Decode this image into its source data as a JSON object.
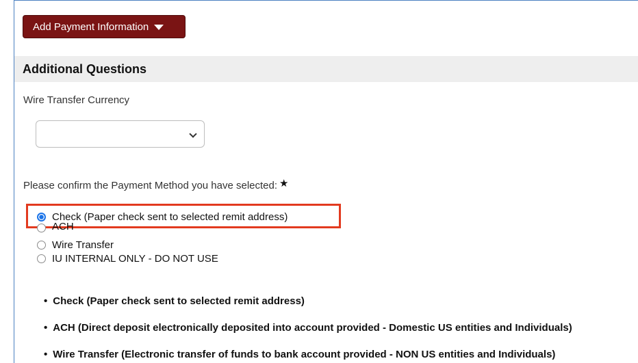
{
  "toolbar": {
    "add_payment_label": "Add Payment Information"
  },
  "section": {
    "title": "Additional Questions"
  },
  "currency_field": {
    "label": "Wire Transfer Currency",
    "selected_value": ""
  },
  "payment_method": {
    "question": "Please confirm the Payment Method you have selected:",
    "required_mark": "★",
    "options": [
      {
        "label": "Check (Paper check sent to selected remit address)",
        "checked": true
      },
      {
        "label": "ACH",
        "checked": false
      },
      {
        "label": "Wire Transfer",
        "checked": false
      },
      {
        "label": "IU INTERNAL ONLY - DO NOT USE",
        "checked": false
      }
    ]
  },
  "descriptions": [
    "Check (Paper check sent to selected remit address)",
    "ACH (Direct deposit electronically deposited into account provided - Domestic US entities and Individuals)",
    "Wire Transfer (Electronic transfer of funds to bank account provided - NON US entities and Individuals)"
  ],
  "colors": {
    "button_bg": "#7a1414",
    "highlight_border": "#e23a1f",
    "radio_selected": "#1a73e8",
    "header_bg": "#eeeeee"
  }
}
